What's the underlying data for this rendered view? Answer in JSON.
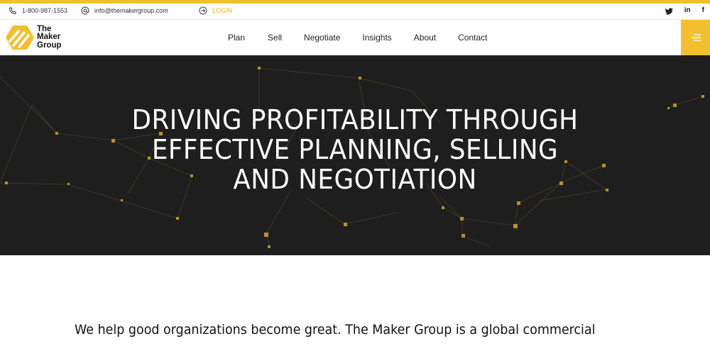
{
  "topbar": {
    "phone": "1-800-987-1553",
    "email": "info@themakergroup.com",
    "login": "LOGIN",
    "social": [
      "twitter",
      "in",
      "f"
    ]
  },
  "logo": {
    "line1": "The",
    "line2": "Maker",
    "line3": "Group"
  },
  "nav": {
    "items": [
      "Plan",
      "Sell",
      "Negotiate",
      "Insights",
      "About",
      "Contact"
    ]
  },
  "hero": {
    "line1": "DRIVING PROFITABILITY THROUGH",
    "line2": "EFFECTIVE PLANNING, SELLING",
    "line3": "AND NEGOTIATION"
  },
  "intro": {
    "text": "We help good organizations become great. The Maker Group is a global commercial"
  },
  "colors": {
    "accent": "#f2bf2f",
    "hero_bg": "#1e1e1e"
  }
}
